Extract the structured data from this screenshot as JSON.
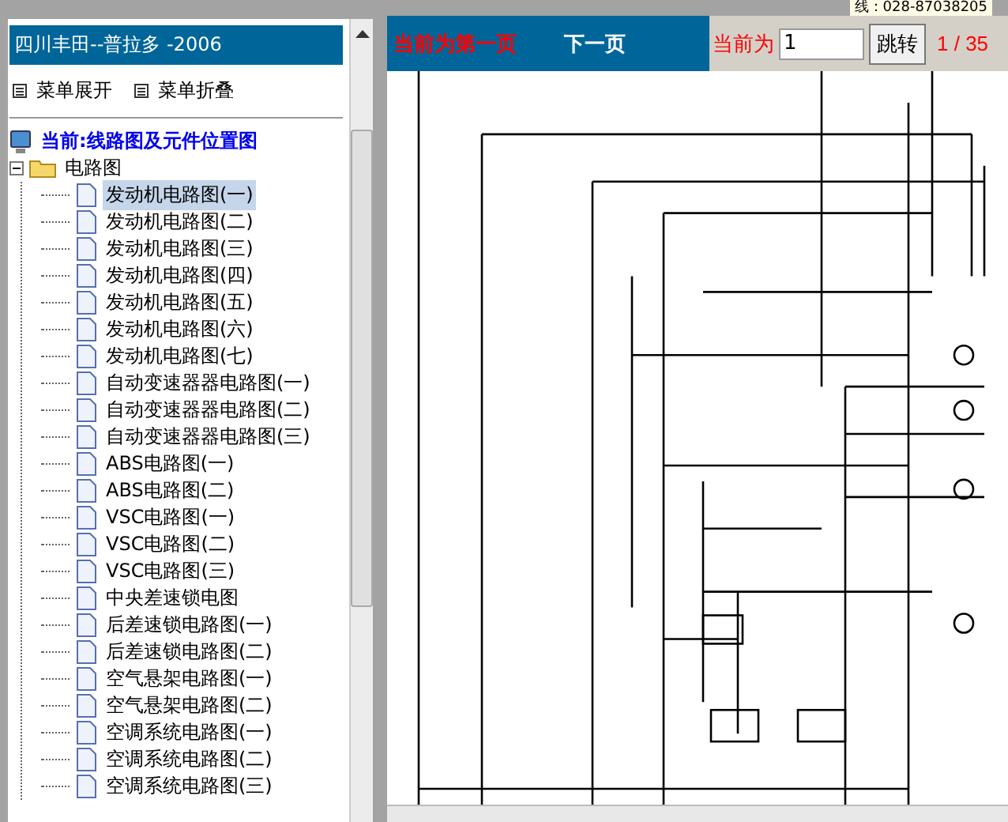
{
  "top_strip": {
    "phone_text": "线：028-87038205"
  },
  "sidebar": {
    "title": "四川丰田--普拉多 -2006",
    "menu_actions": [
      {
        "label": "菜单展开"
      },
      {
        "label": "菜单折叠"
      }
    ],
    "tree": {
      "current": "当前:线路图及元件位置图",
      "folders": [
        {
          "label": "电路图",
          "expanded": true,
          "children": [
            {
              "label": "发动机电路图(一)",
              "selected": true
            },
            {
              "label": "发动机电路图(二)",
              "selected": false
            },
            {
              "label": "发动机电路图(三)",
              "selected": false
            },
            {
              "label": "发动机电路图(四)",
              "selected": false
            },
            {
              "label": "发动机电路图(五)",
              "selected": false
            },
            {
              "label": "发动机电路图(六)",
              "selected": false
            },
            {
              "label": "发动机电路图(七)",
              "selected": false
            },
            {
              "label": "自动变速器器电路图(一)",
              "selected": false
            },
            {
              "label": "自动变速器器电路图(二)",
              "selected": false
            },
            {
              "label": "自动变速器器电路图(三)",
              "selected": false
            },
            {
              "label": "ABS电路图(一)",
              "selected": false
            },
            {
              "label": "ABS电路图(二)",
              "selected": false
            },
            {
              "label": "VSC电路图(一)",
              "selected": false
            },
            {
              "label": "VSC电路图(二)",
              "selected": false
            },
            {
              "label": "VSC电路图(三)",
              "selected": false
            },
            {
              "label": "中央差速锁电图",
              "selected": false
            },
            {
              "label": "后差速锁电路图(一)",
              "selected": false
            },
            {
              "label": "后差速锁电路图(二)",
              "selected": false
            },
            {
              "label": "空气悬架电路图(一)",
              "selected": false
            },
            {
              "label": "空气悬架电路图(二)",
              "selected": false
            },
            {
              "label": "空调系统电路图(一)",
              "selected": false
            },
            {
              "label": "空调系统电路图(二)",
              "selected": false
            },
            {
              "label": "空调系统电路图(三)",
              "selected": false
            }
          ]
        }
      ]
    }
  },
  "viewer": {
    "page_status": "当前为第一页",
    "next_link": "下一页",
    "goto_label": "当前为",
    "page_input": "1",
    "goto_button": "跳转",
    "page_count": "1 / 35"
  }
}
